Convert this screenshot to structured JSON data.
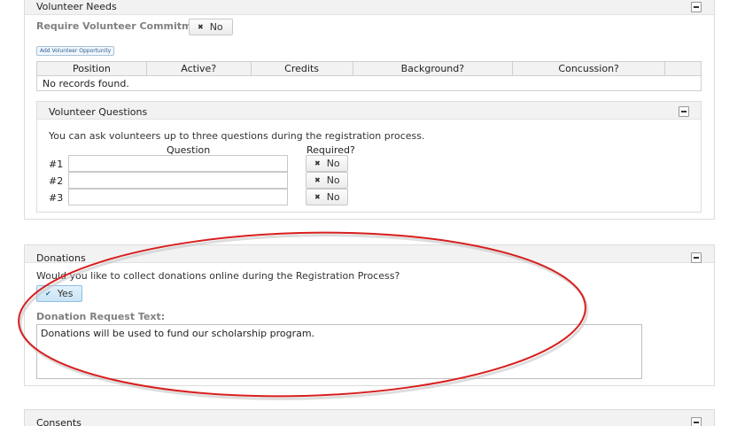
{
  "volunteer_needs": {
    "title": "Volunteer Needs",
    "require_commitment_label": "Require Volunteer Commitment:",
    "require_commitment_value": "No",
    "add_opportunity_label": "Add Volunteer Opportunity",
    "table": {
      "columns": [
        "Position",
        "Active?",
        "Credits",
        "Background?",
        "Concussion?",
        ""
      ],
      "empty_text": "No records found."
    }
  },
  "volunteer_questions": {
    "title": "Volunteer Questions",
    "intro": "You can ask volunteers up to three questions during the registration process.",
    "question_header": "Question",
    "required_header": "Required?",
    "rows": [
      {
        "num": "#1",
        "value": "",
        "required": "No"
      },
      {
        "num": "#2",
        "value": "",
        "required": "No"
      },
      {
        "num": "#3",
        "value": "",
        "required": "No"
      }
    ]
  },
  "donations": {
    "title": "Donations",
    "question": "Would you like to collect donations online during the Registration Process?",
    "collect_value": "Yes",
    "request_text_label": "Donation Request Text:",
    "request_text": "Donations will be used to fund our scholarship program."
  },
  "consents": {
    "title": "Consents"
  },
  "icons": {
    "collapse": "minus-icon",
    "no_mark": "x-icon",
    "yes_mark": "checkmark-icon"
  },
  "colors": {
    "annotation_ring": "#d81e1e",
    "yes_toggle": "#c9e4f6"
  }
}
